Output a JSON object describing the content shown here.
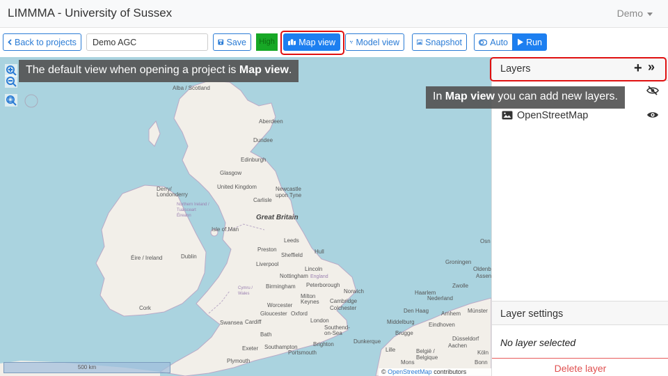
{
  "app": {
    "title": "LIMMMA - University of Sussex",
    "user": "Demo"
  },
  "toolbar": {
    "back_label": "Back to projects",
    "project_name": "Demo AGC",
    "save_label": "Save",
    "quality_label": "High",
    "map_view_label": "Map view",
    "model_view_label": "Model view",
    "snapshot_label": "Snapshot",
    "auto_label": "Auto",
    "run_label": "Run"
  },
  "map": {
    "labels": [
      "Alba / Scotland",
      "Aberdeen",
      "Dundee",
      "Edinburgh",
      "Glasgow",
      "United Kingdom",
      "Newcastle upon Tyne",
      "Carlisle",
      "Derry/ Londonderry",
      "Northern Ireland / Tuaisceart Éireann",
      "Great Britain",
      "Isle of Man",
      "Leeds",
      "Preston",
      "Hull",
      "Sheffield",
      "Liverpool",
      "Éire / Ireland",
      "Dublin",
      "Lincoln",
      "Nottingham",
      "England",
      "Birmingham",
      "Peterborough",
      "Norwich",
      "Cymru / Wales",
      "Milton Keynes",
      "Cambridge",
      "Worcester",
      "Colchester",
      "Gloucester",
      "Oxford",
      "London",
      "Cork",
      "Swansea",
      "Cardiff",
      "Southend-on-Sea",
      "Bath",
      "Brighton",
      "Exeter",
      "Southampton",
      "Portsmouth",
      "Plymouth",
      "Groningen",
      "Oldenburg",
      "Assen",
      "Zwolle",
      "Nederland",
      "Haarlem",
      "Den Haag",
      "Arnhem",
      "Münster",
      "Eindhoven",
      "Middelburg",
      "Brugge",
      "Dunkerque",
      "Lille",
      "Düsseldorf",
      "Aachen",
      "België / Belgique",
      "Köln",
      "Mons",
      "Bonn",
      "Osn"
    ],
    "scale_label": "500 km",
    "attribution_prefix": "©",
    "attribution_link": "OpenStreetMap",
    "attribution_suffix": "contributors",
    "tooltip_map_text": "The default view when opening a project is ",
    "tooltip_map_bold": "Map view",
    "tooltip_map_end": ".",
    "tooltip_layers_prefix": "In ",
    "tooltip_layers_bold": "Map view",
    "tooltip_layers_suffix": " you can add new layers."
  },
  "panel": {
    "layers_title": "Layers",
    "layers": [
      {
        "name": "OpenStreetMap",
        "icon": "image-icon",
        "visible": true
      }
    ],
    "settings_title": "Layer settings",
    "no_layer_text": "No layer selected",
    "delete_label": "Delete layer"
  },
  "colors": {
    "primary": "#1d7ff0",
    "highlight": "#e01010",
    "quality": "#17a826",
    "danger": "#e05050",
    "sea": "#aad3df",
    "land": "#f2efe9"
  }
}
